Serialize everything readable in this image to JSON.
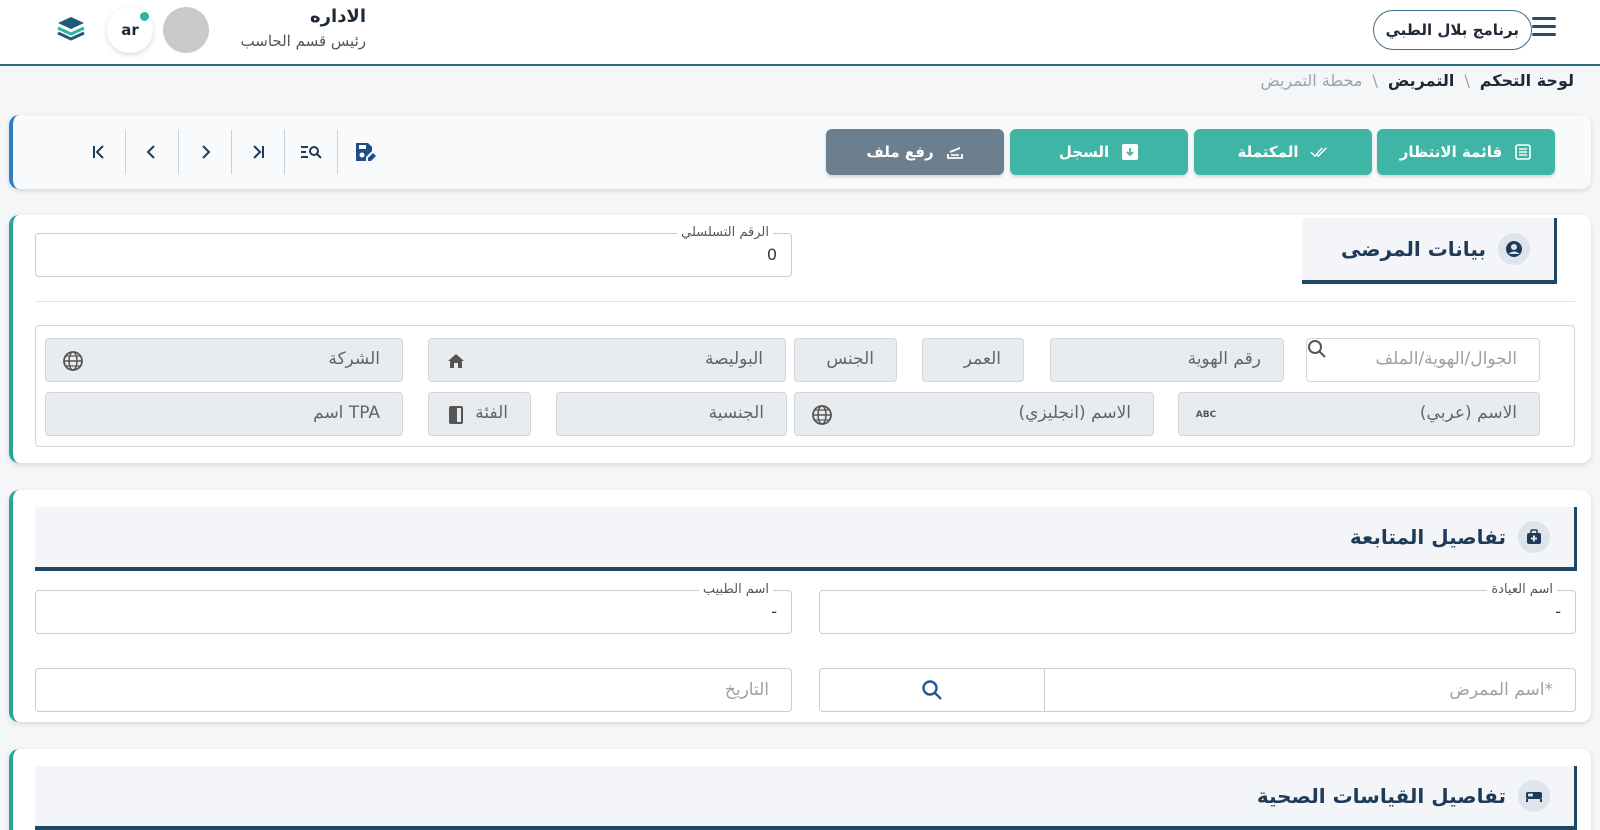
{
  "header": {
    "app_name": "برنامج بلال الطبي",
    "user_name": "الاداره",
    "user_role": "رئيس قسم الحاسب",
    "language": "ar"
  },
  "breadcrumb": {
    "items": [
      "لوحة التحكم",
      "التمريض",
      "محطة التمريض"
    ],
    "separator": "\\"
  },
  "toolbar": {
    "waiting_list": "قائمة الانتظار",
    "completed": "المكتملة",
    "record": "السجل",
    "upload_file": "رفع ملف"
  },
  "patient_section": {
    "title": "بيانات المرضى",
    "serial_label": "الرقم التسلسلي",
    "serial_value": "0",
    "search_placeholder": "الجوال/الهوية/الملف",
    "id_number": "رقم الهوية",
    "age": "العمر",
    "gender": "الجنس",
    "policy": "البوليصة",
    "company": "الشركة",
    "name_arabic": "الاسم (عربي)",
    "name_english": "الاسم (انجليزي)",
    "nationality": "الجنسية",
    "category": "الفئة",
    "tpa_name": "اسم TPA"
  },
  "followup_section": {
    "title": "تفاصيل المتابعة",
    "clinic_label": "اسم العيادة",
    "clinic_value": "-",
    "doctor_label": "اسم الطبيب",
    "doctor_value": "-",
    "nurse_placeholder": "اسم الممرض*",
    "date_placeholder": "التاريخ"
  },
  "vitals_section": {
    "title": "تفاصيل القياسات الصحية"
  },
  "colors": {
    "teal": "#3fb5a5",
    "navy": "#1f4866",
    "gray_button": "#6b7f8e"
  }
}
